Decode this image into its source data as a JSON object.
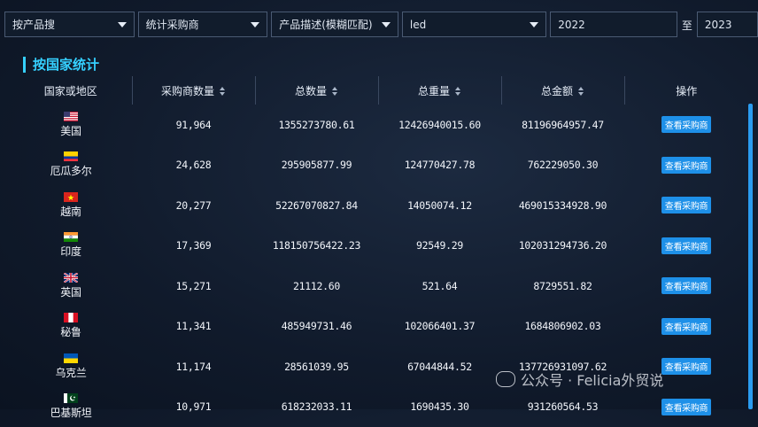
{
  "filters": [
    {
      "value": "按产品搜",
      "width": 149,
      "caret": true
    },
    {
      "value": "统计采购商",
      "width": 149,
      "caret": true
    },
    {
      "value": "产品描述(模糊匹配)",
      "width": 146,
      "caret": true
    },
    {
      "value": "led",
      "width": 166,
      "caret": true
    },
    {
      "value": "2022",
      "width": 146,
      "caret": false
    }
  ],
  "to_label": "至",
  "end_year": "2023",
  "section_title": "按国家统计",
  "columns": [
    "国家或地区",
    "采购商数量",
    "总数量",
    "总重量",
    "总金额",
    "操作"
  ],
  "action_label": "查看采购商",
  "rows": [
    {
      "country": "美国",
      "flag": "us",
      "buyers": "91,964",
      "qty": "1355273780.61",
      "weight": "12426940015.60",
      "amount": "81196964957.47"
    },
    {
      "country": "厄瓜多尔",
      "flag": "ec",
      "buyers": "24,628",
      "qty": "295905877.99",
      "weight": "124770427.78",
      "amount": "762229050.30"
    },
    {
      "country": "越南",
      "flag": "vn",
      "buyers": "20,277",
      "qty": "52267070827.84",
      "weight": "14050074.12",
      "amount": "469015334928.90"
    },
    {
      "country": "印度",
      "flag": "in",
      "buyers": "17,369",
      "qty": "118150756422.23",
      "weight": "92549.29",
      "amount": "102031294736.20"
    },
    {
      "country": "英国",
      "flag": "gb",
      "buyers": "15,271",
      "qty": "21112.60",
      "weight": "521.64",
      "amount": "8729551.82"
    },
    {
      "country": "秘鲁",
      "flag": "pe",
      "buyers": "11,341",
      "qty": "485949731.46",
      "weight": "102066401.37",
      "amount": "1684806902.03"
    },
    {
      "country": "乌克兰",
      "flag": "ua",
      "buyers": "11,174",
      "qty": "28561039.95",
      "weight": "67044844.52",
      "amount": "137726931097.62"
    },
    {
      "country": "巴基斯坦",
      "flag": "pk",
      "buyers": "10,971",
      "qty": "618232033.11",
      "weight": "1690435.30",
      "amount": "931260564.53"
    }
  ],
  "watermark": "公众号 · Felicia外贸说"
}
